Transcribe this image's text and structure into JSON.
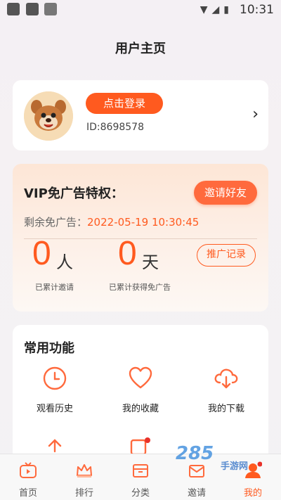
{
  "status_bar": {
    "time": "10:31"
  },
  "header": {
    "title": "用户主页"
  },
  "profile": {
    "login_label": "点击登录",
    "user_id": "ID:8698578"
  },
  "vip": {
    "title": "VIP免广告特权：",
    "invite_label": "邀请好友",
    "remaining_label": "剩余免广告：",
    "remaining_date": "2022-05-19 10:30:45",
    "invited_count": "0",
    "invited_unit": "人",
    "invited_label": "已累计邀请",
    "days_count": "0",
    "days_unit": "天",
    "days_label": "已累计获得免广告",
    "record_label": "推广记录"
  },
  "functions": {
    "title": "常用功能",
    "items": [
      {
        "label": "观看历史",
        "icon": "clock-icon"
      },
      {
        "label": "我的收藏",
        "icon": "heart-icon"
      },
      {
        "label": "我的下载",
        "icon": "cloud-download-icon"
      }
    ]
  },
  "tabs": [
    {
      "label": "首页",
      "icon": "tv-icon"
    },
    {
      "label": "排行",
      "icon": "crown-icon"
    },
    {
      "label": "分类",
      "icon": "box-icon"
    },
    {
      "label": "邀请",
      "icon": "invite-icon"
    },
    {
      "label": "我的",
      "icon": "user-icon",
      "active": true
    }
  ],
  "watermark": {
    "text": "285",
    "sub": "手游网"
  },
  "colors": {
    "accent": "#ff5a1f",
    "accent_light": "#ff6a3d"
  }
}
